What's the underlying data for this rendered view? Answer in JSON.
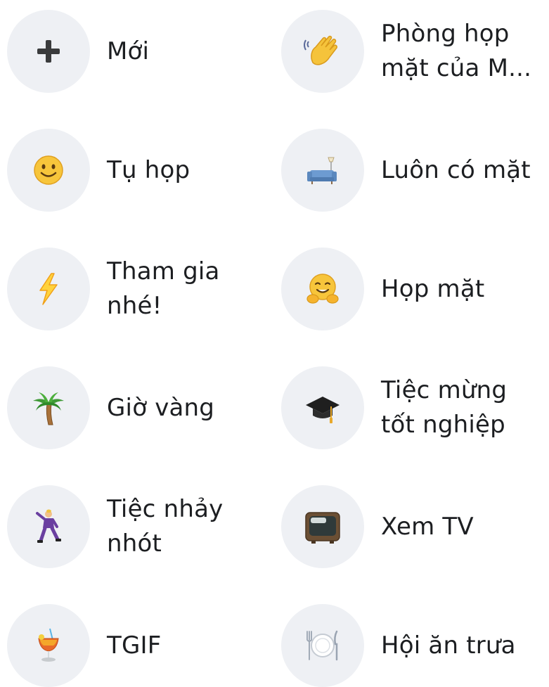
{
  "options": [
    {
      "key": "new",
      "icon": "plus-icon",
      "lines": [
        "Mới"
      ]
    },
    {
      "key": "meeting-room",
      "icon": "waving-hand-icon",
      "lines": [
        "Phòng họp",
        "mặt của M..."
      ]
    },
    {
      "key": "hangout",
      "icon": "smiley-face-icon",
      "lines": [
        "Tụ họp"
      ]
    },
    {
      "key": "always-there",
      "icon": "couch-lamp-icon",
      "lines": [
        "Luôn có mặt"
      ]
    },
    {
      "key": "join-us",
      "icon": "lightning-icon",
      "lines": [
        "Tham gia",
        "nhé!"
      ]
    },
    {
      "key": "get-together",
      "icon": "hugging-face-icon",
      "lines": [
        "Họp mặt"
      ]
    },
    {
      "key": "happy-hour",
      "icon": "palm-tree-icon",
      "lines": [
        "Giờ vàng"
      ]
    },
    {
      "key": "graduation",
      "icon": "graduation-cap-icon",
      "lines": [
        "Tiệc mừng",
        "tốt nghiệp"
      ]
    },
    {
      "key": "dance-party",
      "icon": "dancing-man-icon",
      "lines": [
        "Tiệc nhảy",
        "nhót"
      ]
    },
    {
      "key": "watch-tv",
      "icon": "television-icon",
      "lines": [
        "Xem TV"
      ]
    },
    {
      "key": "tgif",
      "icon": "tropical-drink-icon",
      "lines": [
        "TGIF"
      ]
    },
    {
      "key": "lunch",
      "icon": "fork-plate-knife-icon",
      "lines": [
        "Hội ăn trưa"
      ]
    }
  ]
}
